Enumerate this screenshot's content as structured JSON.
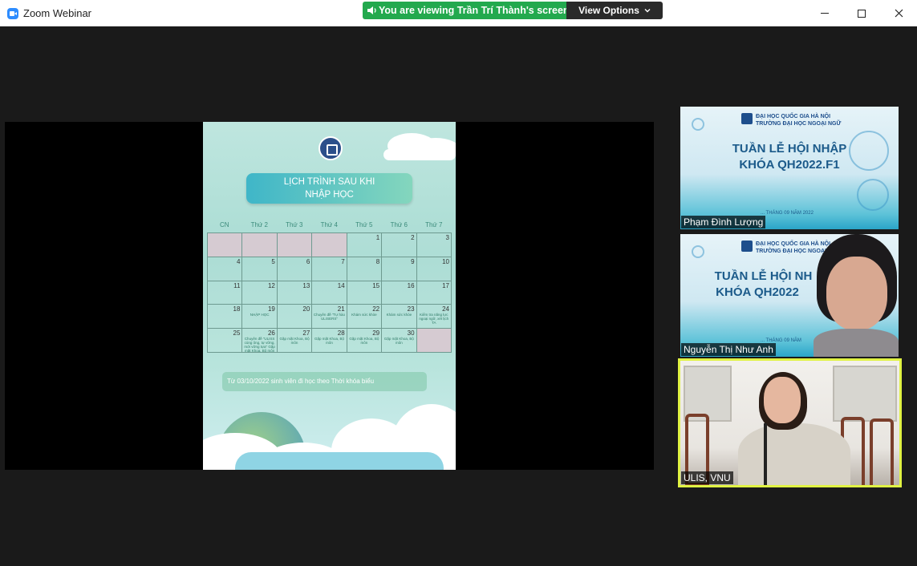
{
  "window": {
    "title": "Zoom Webinar",
    "controls": [
      "minimize",
      "maximize",
      "close"
    ]
  },
  "share_banner": {
    "text": "You are viewing Trần Trí Thành's screen",
    "view_options_label": "View Options"
  },
  "poster": {
    "title_line1": "LỊCH TRÌNH SAU KHI",
    "title_line2": "NHẬP HỌC",
    "weekdays": [
      "CN",
      "Thứ 2",
      "Thứ 3",
      "Thứ 4",
      "Thứ 5",
      "Thứ 6",
      "Thứ 7"
    ],
    "cells": [
      {
        "num": "",
        "ev": ""
      },
      {
        "num": "",
        "ev": ""
      },
      {
        "num": "",
        "ev": ""
      },
      {
        "num": "",
        "ev": ""
      },
      {
        "num": "1",
        "ev": ""
      },
      {
        "num": "2",
        "ev": ""
      },
      {
        "num": "3",
        "ev": ""
      },
      {
        "num": "4",
        "ev": ""
      },
      {
        "num": "5",
        "ev": ""
      },
      {
        "num": "6",
        "ev": ""
      },
      {
        "num": "7",
        "ev": ""
      },
      {
        "num": "8",
        "ev": ""
      },
      {
        "num": "9",
        "ev": ""
      },
      {
        "num": "10",
        "ev": ""
      },
      {
        "num": "11",
        "ev": ""
      },
      {
        "num": "12",
        "ev": ""
      },
      {
        "num": "13",
        "ev": ""
      },
      {
        "num": "14",
        "ev": ""
      },
      {
        "num": "15",
        "ev": ""
      },
      {
        "num": "16",
        "ev": ""
      },
      {
        "num": "17",
        "ev": ""
      },
      {
        "num": "18",
        "ev": ""
      },
      {
        "num": "19",
        "ev": "NHẬP HỌC"
      },
      {
        "num": "20",
        "ev": ""
      },
      {
        "num": "21",
        "ev": "Chuyên đề \"Tự hào ULISERS\""
      },
      {
        "num": "22",
        "ev": "Khám sức khỏe"
      },
      {
        "num": "23",
        "ev": "Khám sức khỏe"
      },
      {
        "num": "24",
        "ev": "Kiểm tra năng lực ngoại ngữ, xét lịch TA"
      },
      {
        "num": "25",
        "ev": ""
      },
      {
        "num": "26",
        "ev": "Chuyên đề \"ULISS cùng ông, tự vững, mới vững tựa\" Gặp mặt Khoa, Bộ môn"
      },
      {
        "num": "27",
        "ev": "Gặp mặt Khoa, Bộ môn"
      },
      {
        "num": "28",
        "ev": "Gặp mặt Khoa, Bộ môn"
      },
      {
        "num": "29",
        "ev": "Gặp mặt Khoa, Bộ môn"
      },
      {
        "num": "30",
        "ev": "Gặp mặt Khoa, Bộ môn"
      },
      {
        "num": "",
        "ev": ""
      }
    ],
    "note": "Từ 03/10/2022 sinh viên đi học theo Thời khóa biểu"
  },
  "participants": [
    {
      "name": "Phạm Đình Lượng",
      "slide": {
        "uni1": "ĐẠI HỌC QUỐC GIA HÀ NỘI",
        "uni2": "TRƯỜNG ĐẠI HỌC NGOẠI NGỮ",
        "line1": "TUẦN LỄ HỘI NHẬP",
        "line2": "KHÓA QH2022.F1",
        "date": "... THÁNG 09 NĂM 2022"
      }
    },
    {
      "name": "Nguyễn Thị Như Anh",
      "slide": {
        "uni1": "ĐẠI HỌC QUỐC GIA HÀ NỘI",
        "uni2": "TRƯỜNG ĐẠI HỌC NGOẠI NGỮ",
        "line1": "TUẦN LỄ HỘI NH",
        "line2": "KHÓA QH2022",
        "date": "... THÁNG 09 NĂM"
      }
    },
    {
      "name": "ULIS, VNU",
      "active_speaker": true
    }
  ],
  "colors": {
    "banner_green": "#23a94e",
    "active_speaker_border": "#e0f243",
    "background": "#1a1a1a"
  }
}
